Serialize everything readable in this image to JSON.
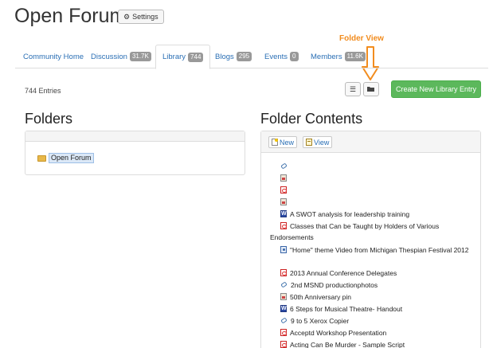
{
  "page": {
    "title": "Open Forum",
    "settings_label": "Settings"
  },
  "annotation": {
    "label": "Folder View",
    "color": "#f28c1e"
  },
  "tabs": [
    {
      "label": "Community Home",
      "badge": ""
    },
    {
      "label": "Discussion",
      "badge": "31.7K"
    },
    {
      "label": "Library",
      "badge": "744",
      "active": true
    },
    {
      "label": "Blogs",
      "badge": "295"
    },
    {
      "label": "Events",
      "badge": "0"
    },
    {
      "label": "Members",
      "badge": "11.6K"
    }
  ],
  "toolbar": {
    "entries": "744 Entries",
    "list_view_icon": "list-icon",
    "folder_view_icon": "folder-open-icon",
    "create_label": "Create New Library Entry",
    "create_color": "#5cb85c"
  },
  "folders": {
    "title": "Folders",
    "items": [
      {
        "label": "Open Forum",
        "icon": "folder-icon"
      }
    ]
  },
  "contents": {
    "title": "Folder Contents",
    "new_label": "New",
    "view_label": "View",
    "files": [
      {
        "icon": "link",
        "name": ""
      },
      {
        "icon": "image",
        "name": ""
      },
      {
        "icon": "pdf",
        "name": ""
      },
      {
        "icon": "image",
        "name": ""
      },
      {
        "icon": "word",
        "name": "A SWOT analysis for leadership training"
      },
      {
        "icon": "pdf",
        "name": "Classes that Can be Taught by Holders of Various Endorsements"
      },
      {
        "icon": "video",
        "name": "\"Home\" theme Video from Michigan Thespian Festival 2012"
      },
      {
        "icon": "pdf",
        "name": "2013 Annual Conference Delegates"
      },
      {
        "icon": "link",
        "name": "2nd MSND productionphotos"
      },
      {
        "icon": "image",
        "name": "50th Anniversary pin"
      },
      {
        "icon": "word",
        "name": "6 Steps for Musical Theatre- Handout"
      },
      {
        "icon": "link",
        "name": "9 to 5 Xerox Copier"
      },
      {
        "icon": "pdf",
        "name": "Acceptd Workshop Presentation"
      },
      {
        "icon": "pdf",
        "name": "Acting Can Be Murder - Sample Script"
      }
    ]
  }
}
